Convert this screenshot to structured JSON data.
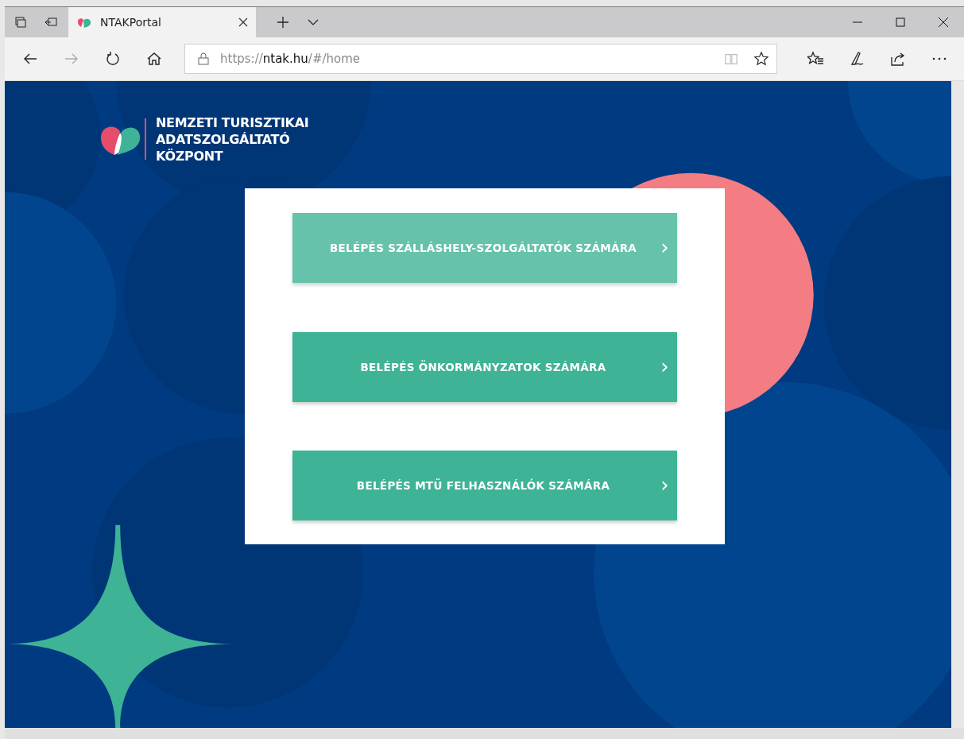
{
  "browser": {
    "tab": {
      "title": "NTAKPortal",
      "selected": true
    },
    "url": {
      "scheme": "https://",
      "host": "ntak.hu",
      "path": "/#/home"
    }
  },
  "logo": {
    "lines": [
      "NEMZETI TURISZTIKAI",
      "ADATSZOLGÁLTATÓ",
      "KÖZPONT"
    ]
  },
  "buttons": [
    {
      "label": "BELÉPÉS SZÁLLÁSHELY-SZOLGÁLTATÓK SZÁMÁRA",
      "chevron": "›",
      "hovered": true
    },
    {
      "label": "BELÉPÉS ÖNKORMÁNYZATOK SZÁMÁRA",
      "chevron": "›",
      "hovered": false
    },
    {
      "label": "BELÉPÉS MTÜ FELHASZNÁLÓK SZÁMÁRA",
      "chevron": "›",
      "hovered": false
    }
  ]
}
